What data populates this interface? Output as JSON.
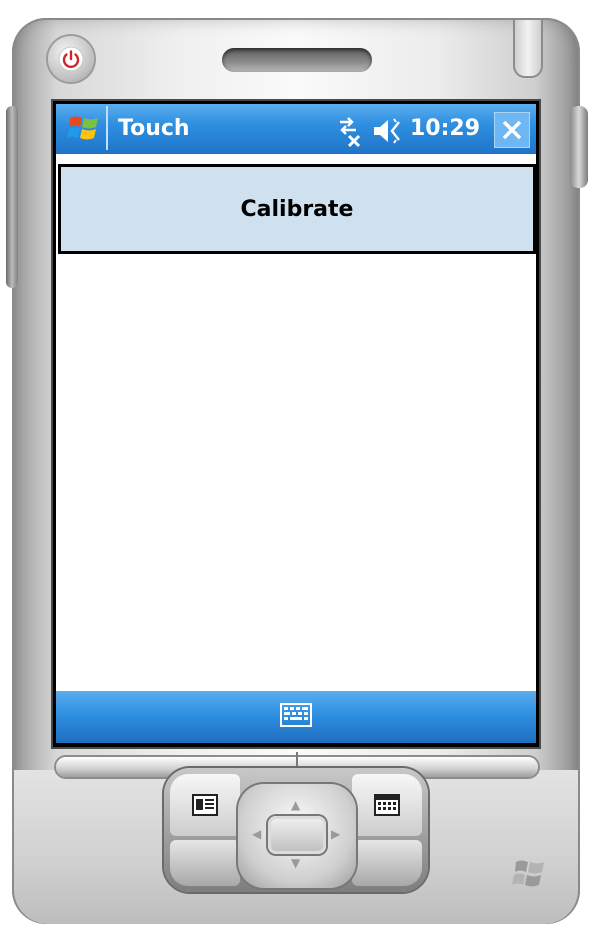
{
  "window": {
    "title": "Touch",
    "clock": "10:29"
  },
  "content": {
    "calibrate_button": "Calibrate"
  },
  "icons": {
    "start": "windows-flag-icon",
    "connectivity": "connectivity-icon",
    "volume": "volume-muted-icon",
    "close": "close-icon",
    "keyboard": "keyboard-icon",
    "power": "power-icon"
  },
  "colors": {
    "titlebar": "#2f8fe0",
    "button_face": "#cfe0ef",
    "power_red": "#d2232a"
  }
}
